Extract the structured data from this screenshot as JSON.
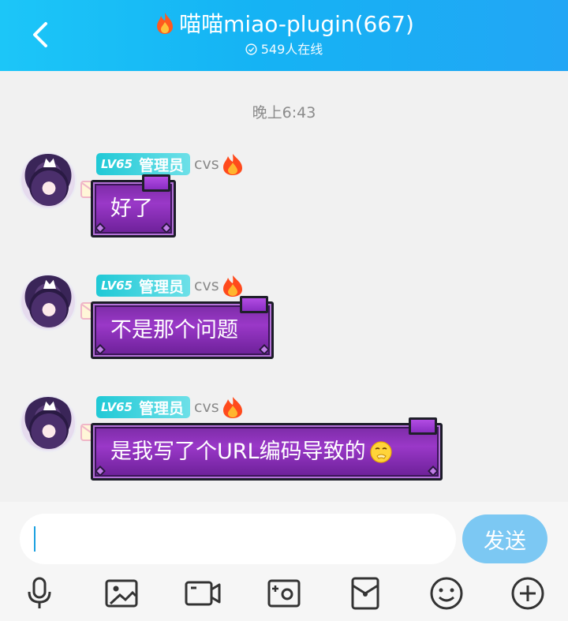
{
  "header": {
    "title": "喵喵miao-plugin(667)",
    "online": "549人在线",
    "back_icon": "back-arrow-icon"
  },
  "timestamp": "晚上6:43",
  "messages": [
    {
      "level": "LV65",
      "role": "管理员",
      "sender": "cvs",
      "text": "好了",
      "emoji": ""
    },
    {
      "level": "LV65",
      "role": "管理员",
      "sender": "cvs",
      "text": "不是那个问题",
      "emoji": ""
    },
    {
      "level": "LV65",
      "role": "管理员",
      "sender": "cvs",
      "text": "是我写了个URL编码导致的",
      "emoji": "facepalm-emoji"
    }
  ],
  "input": {
    "value": "",
    "send_label": "发送"
  },
  "toolbar": [
    "microphone-icon",
    "image-icon",
    "video-icon",
    "camera-icon",
    "red-packet-icon",
    "emoji-icon",
    "plus-icon"
  ],
  "colors": {
    "header": "#15b3f4",
    "bubble": "#8a33b8",
    "send": "#7cc8f3",
    "badge": "#20c9d6"
  }
}
